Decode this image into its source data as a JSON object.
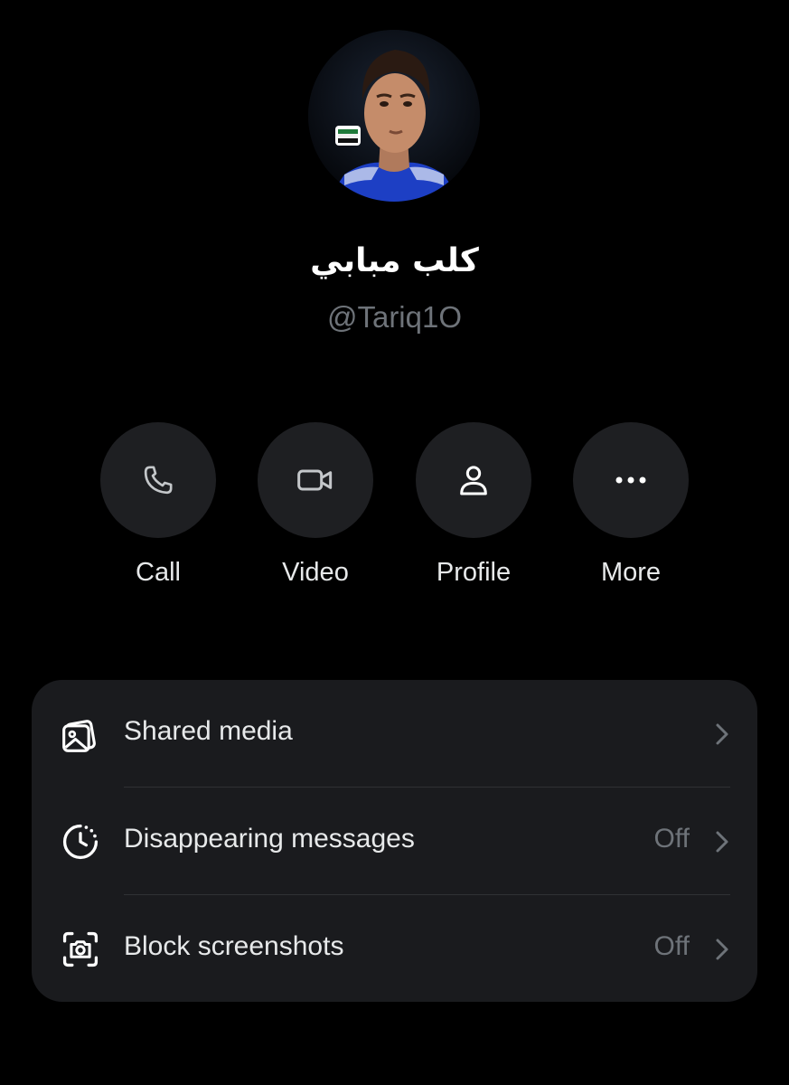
{
  "contact": {
    "name": "كلب مبابي",
    "handle": "@Tariq1O"
  },
  "actions": [
    {
      "label": "Call",
      "icon": "phone-icon"
    },
    {
      "label": "Video",
      "icon": "video-camera-icon"
    },
    {
      "label": "Profile",
      "icon": "person-icon"
    },
    {
      "label": "More",
      "icon": "more-dots-icon"
    }
  ],
  "settings": [
    {
      "label": "Shared media",
      "value": "",
      "icon": "image-stack-icon"
    },
    {
      "label": "Disappearing messages",
      "value": "Off",
      "icon": "timer-icon"
    },
    {
      "label": "Block screenshots",
      "value": "Off",
      "icon": "screenshot-camera-icon"
    }
  ],
  "colors": {
    "background": "#000000",
    "button_bg": "#1e1f22",
    "card_bg": "#1a1b1e",
    "secondary_text": "#6e7379",
    "primary_text": "#e7e9ea"
  }
}
